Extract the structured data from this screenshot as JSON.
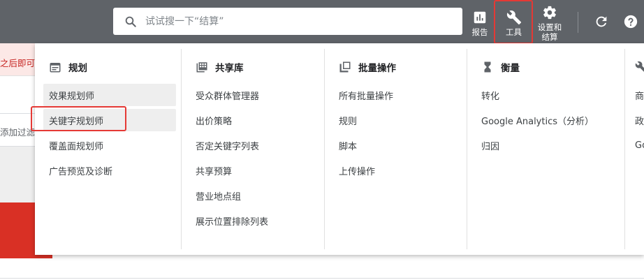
{
  "search": {
    "placeholder": "试试搜一下“结算”"
  },
  "toolbar": {
    "reports_label": "报告",
    "tools_label": "工具",
    "settings_label_line1": "设置和",
    "settings_label_line2": "结算"
  },
  "background": {
    "banner_text": "之后即可开",
    "filter_text": "添加过滤"
  },
  "menu": {
    "planning": {
      "title": "规划",
      "items": [
        "效果规划师",
        "关键字规划师",
        "覆盖面规划师",
        "广告预览及诊断"
      ]
    },
    "shared_library": {
      "title": "共享库",
      "items": [
        "受众群体管理器",
        "出价策略",
        "否定关键字列表",
        "共享预算",
        "营业地点组",
        "展示位置排除列表"
      ]
    },
    "bulk_actions": {
      "title": "批量操作",
      "items": [
        "所有批量操作",
        "规则",
        "脚本",
        "上传操作"
      ]
    },
    "measurement": {
      "title": "衡量",
      "items": [
        "转化",
        "Google Analytics（分析）",
        "归因"
      ]
    },
    "setup": {
      "items": [
        "商",
        "政",
        "Go"
      ]
    }
  },
  "colors": {
    "topbar": "#5f6368",
    "highlight": "#e53935",
    "active_item": "#eeeeee"
  }
}
